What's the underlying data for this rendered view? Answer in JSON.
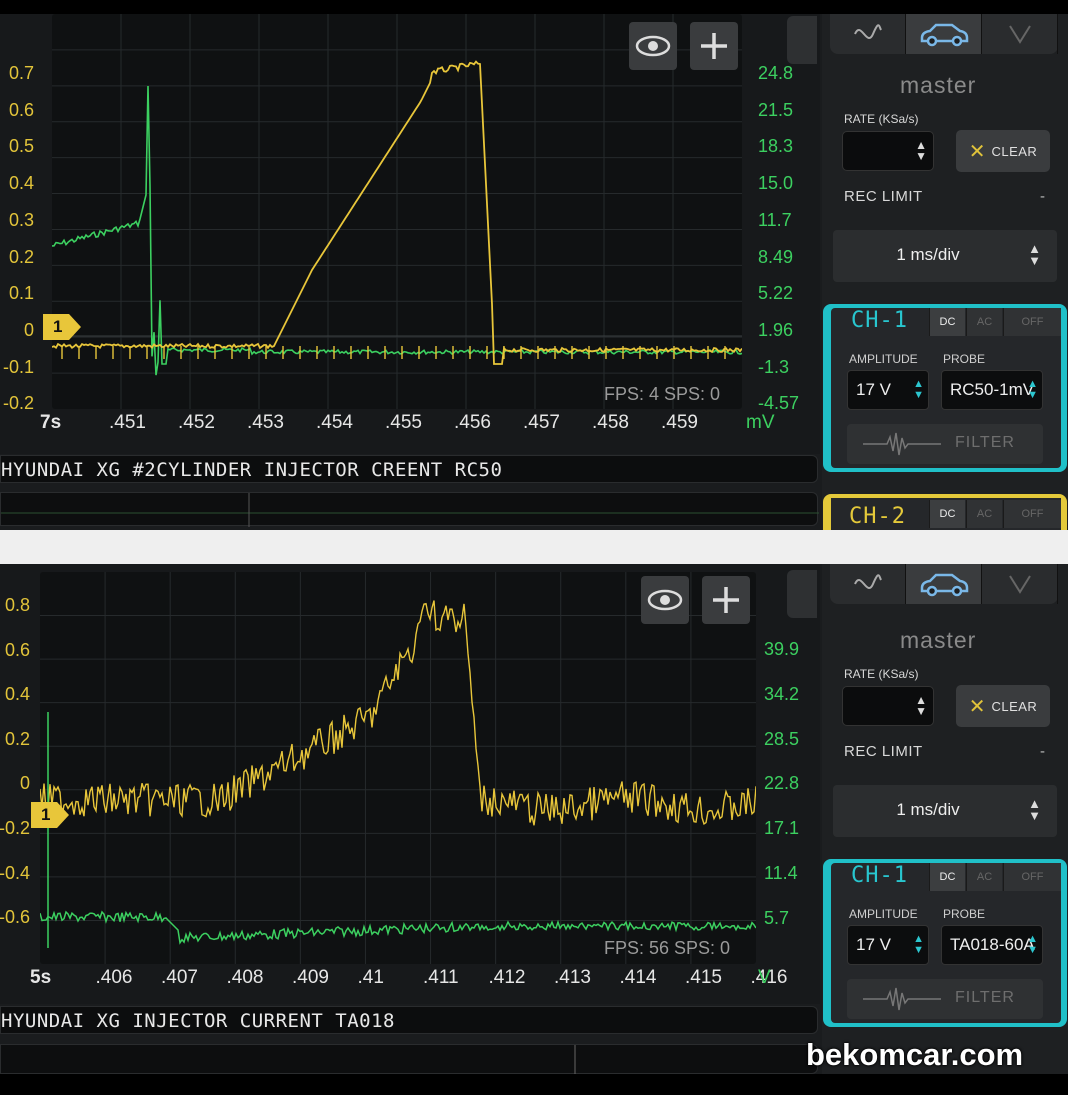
{
  "top": {
    "y_left_ticks": [
      "0.7",
      "0.6",
      "0.5",
      "0.4",
      "0.3",
      "0.2",
      "0.1",
      "0",
      "-0.1",
      "-0.2"
    ],
    "y_right_ticks": [
      "24.8",
      "21.5",
      "18.3",
      "15.0",
      "11.7",
      "8.49",
      "5.22",
      "1.96",
      "-1.3",
      "-4.57"
    ],
    "x_ticks": [
      "7s",
      ".451",
      ".452",
      ".453",
      ".454",
      ".455",
      ".456",
      ".457",
      ".458",
      ".459"
    ],
    "x_unit": "mV",
    "fps": "FPS: 4  SPS: 0",
    "marker": "1",
    "caption": "HYUNDAI XG #2CYLINDER INJECTOR CREENT RC50",
    "side": {
      "master": "master",
      "rate_label": "RATE (KSa/s)",
      "clear": "CLEAR",
      "rec_limit": "REC LIMIT",
      "rec_limit_value": "-",
      "time_div": "1 ms/div",
      "ch1": "CH-1",
      "coupling": [
        "DC",
        "AC",
        "OFF"
      ],
      "amplitude_label": "AMPLITUDE",
      "probe_label": "PROBE",
      "amplitude": "17 V",
      "probe": "RC50-1mV",
      "filter": "FILTER",
      "ch2": "CH-2",
      "ch2_coupling": [
        "DC",
        "AC",
        "OFF"
      ]
    }
  },
  "bottom": {
    "y_left_ticks": [
      "0.8",
      "0.6",
      "0.4",
      "0.2",
      "0",
      "-0.2",
      "-0.4",
      "-0.6"
    ],
    "y_right_ticks": [
      "39.9",
      "34.2",
      "28.5",
      "22.8",
      "17.1",
      "11.4",
      "5.7"
    ],
    "x_ticks": [
      "5s",
      ".406",
      ".407",
      ".408",
      ".409",
      ".41",
      ".411",
      ".412",
      ".413",
      ".414",
      ".415",
      ".416"
    ],
    "x_unit": "V",
    "fps": "FPS: 56  SPS: 0",
    "marker": "1",
    "caption": "HYUNDAI XG INJECTOR CURRENT TA018",
    "side": {
      "master": "master",
      "rate_label": "RATE (KSa/s)",
      "clear": "CLEAR",
      "rec_limit": "REC LIMIT",
      "rec_limit_value": "-",
      "time_div": "1 ms/div",
      "ch1": "CH-1",
      "coupling": [
        "DC",
        "AC",
        "OFF"
      ],
      "amplitude_label": "AMPLITUDE",
      "probe_label": "PROBE",
      "amplitude": "17 V",
      "probe": "TA018-60A",
      "filter": "FILTER"
    }
  },
  "watermark": "bekomcar.com",
  "colors": {
    "ch1_yellow": "#e8c63a",
    "ch2_green": "#3cd060",
    "accent_cyan": "#28c6cf"
  }
}
